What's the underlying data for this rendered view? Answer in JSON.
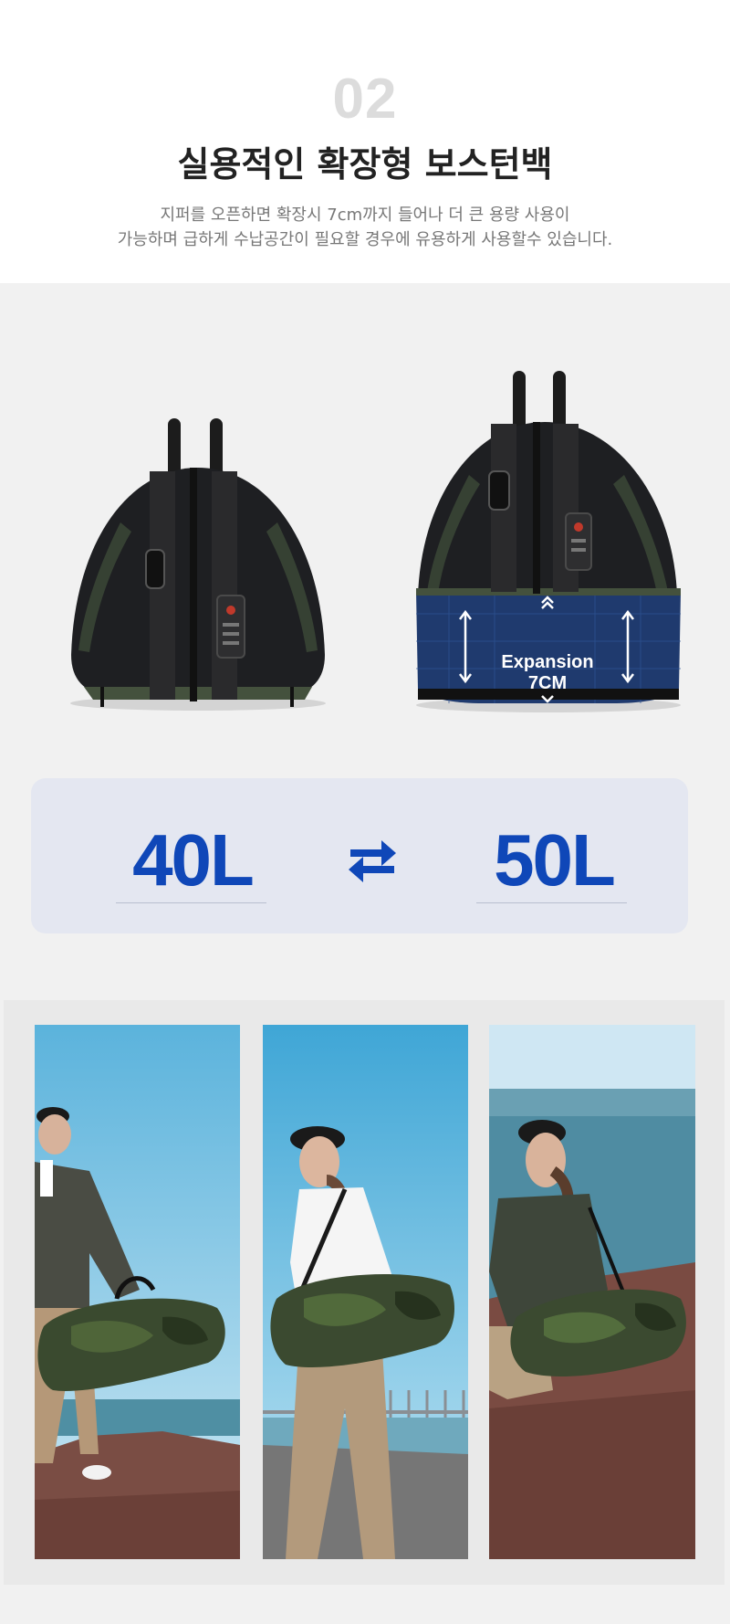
{
  "section": {
    "number": "02",
    "title": "실용적인 확장형 보스턴백",
    "description_lines": [
      "지퍼를 오픈하면 확장시 7cm까지 들어나 더 큰 용량 사용이",
      "가능하며 급하게 수납공간이 필요할 경우에 유용하게 사용할수 있습니다."
    ]
  },
  "product_images": {
    "expansion_label_line1": "Expansion",
    "expansion_label_line2": "7CM"
  },
  "capacity": {
    "before": "40L",
    "after": "50L",
    "swap_icon": "swap-arrows-icon"
  },
  "colors": {
    "accent_blue": "#0f47b8",
    "panel_bg": "#e4e7f1",
    "page_bg": "#f1f1f1",
    "number_gray": "#dcdcdc"
  }
}
